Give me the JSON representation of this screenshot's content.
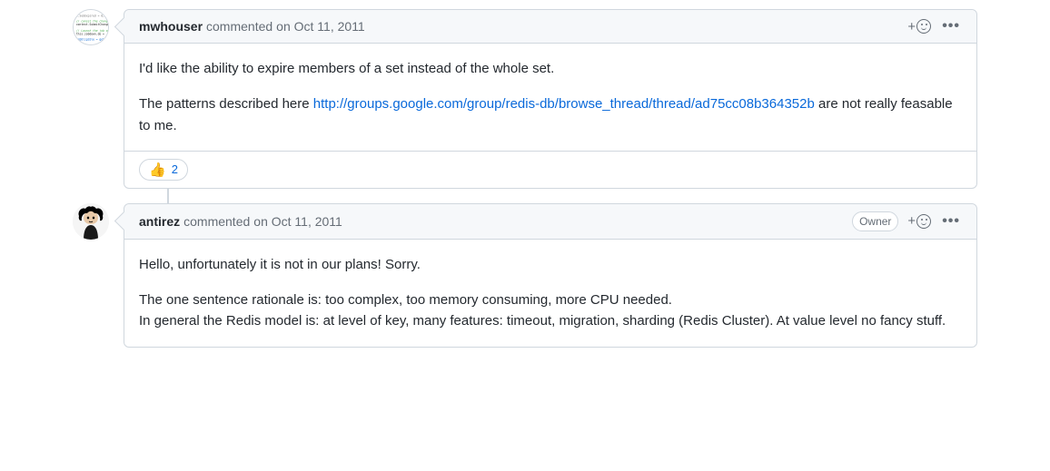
{
  "comments": [
    {
      "author": "mwhouser",
      "verb": "commented",
      "timestamp": "on Oct 11, 2011",
      "badge": null,
      "body_line1": "I'd like the ability to expire members of a set instead of the whole set.",
      "body_line2_prefix": "The patterns described here ",
      "body_line2_link": "http://groups.google.com/group/redis-db/browse_thread/thread/ad75cc08b364352b",
      "body_line2_suffix": " are not really feasable to me.",
      "reactions": [
        {
          "emoji": "👍",
          "count": "2"
        }
      ]
    },
    {
      "author": "antirez",
      "verb": "commented",
      "timestamp": "on Oct 11, 2011",
      "badge": "Owner",
      "body_line1": "Hello, unfortunately it is not in our plans! Sorry.",
      "body_line2": "The one sentence rationale is: too complex, too memory consuming, more CPU needed.",
      "body_line3": "In general the Redis model is: at level of key, many features: timeout, migration, sharding (Redis Cluster). At value level no fancy stuff."
    }
  ]
}
